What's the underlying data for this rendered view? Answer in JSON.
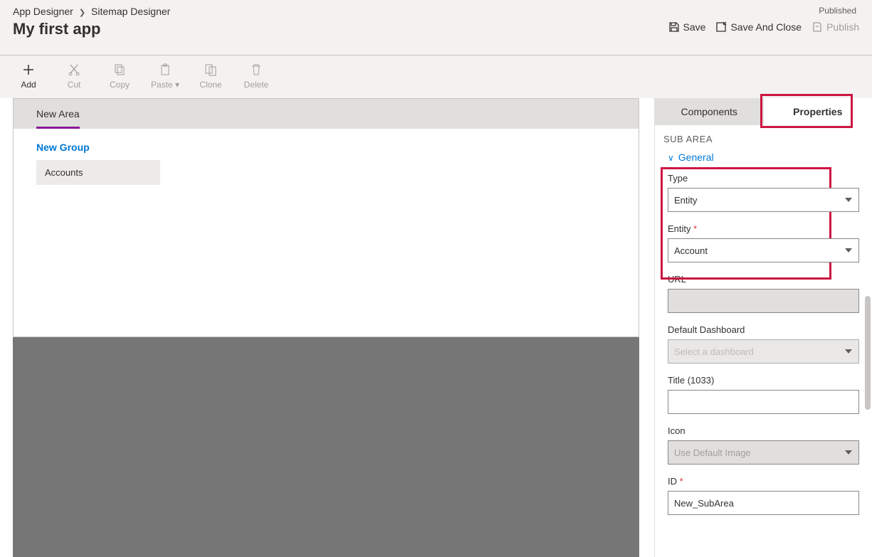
{
  "breadcrumb": {
    "item1": "App Designer",
    "item2": "Sitemap Designer"
  },
  "app_name": "My first app",
  "status": "Published",
  "header_actions": {
    "save": "Save",
    "save_close": "Save And Close",
    "publish": "Publish"
  },
  "toolbar": {
    "add": "Add",
    "cut": "Cut",
    "copy": "Copy",
    "paste": "Paste",
    "clone": "Clone",
    "delete": "Delete"
  },
  "canvas": {
    "area": "New Area",
    "group": "New Group",
    "subarea": "Accounts"
  },
  "panel": {
    "tabs": {
      "components": "Components",
      "properties": "Properties"
    },
    "section_title": "SUB AREA",
    "general_header": "General",
    "fields": {
      "type_label": "Type",
      "type_value": "Entity",
      "entity_label": "Entity",
      "entity_value": "Account",
      "url_label": "URL",
      "url_value": "",
      "dashboard_label": "Default Dashboard",
      "dashboard_placeholder": "Select a dashboard",
      "title_label": "Title (1033)",
      "title_value": "",
      "icon_label": "Icon",
      "icon_value": "Use Default Image",
      "id_label": "ID",
      "id_value": "New_SubArea"
    }
  }
}
